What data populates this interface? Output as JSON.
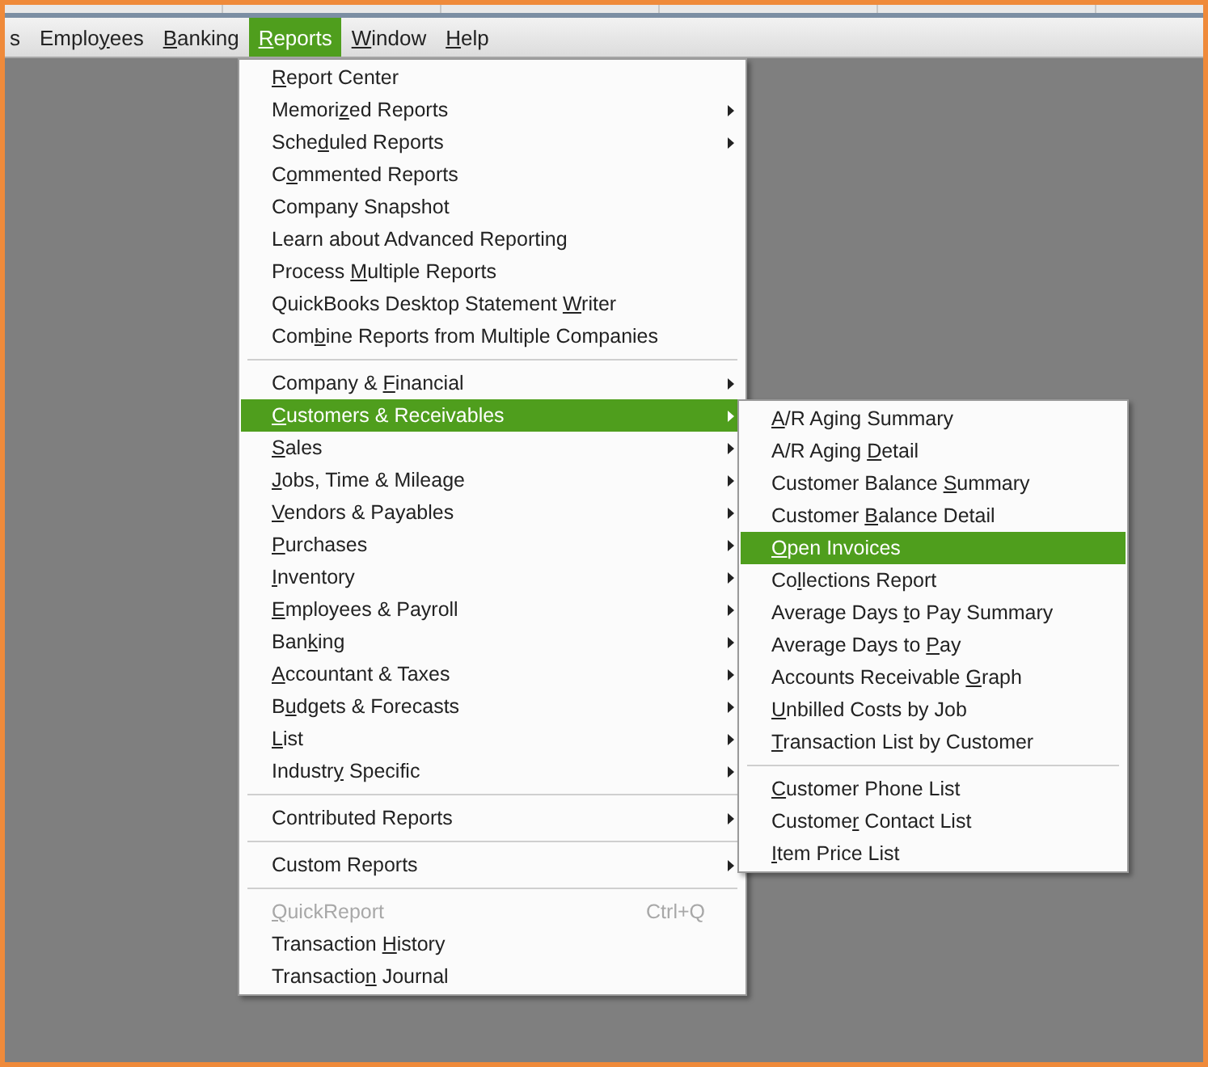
{
  "menu_bar": {
    "items": [
      {
        "label": "s",
        "selected": false
      },
      {
        "accel": {
          "before": "Emplo",
          "key": "y",
          "after": "ees"
        },
        "selected": false
      },
      {
        "accel": {
          "key": "B",
          "after": "anking"
        },
        "selected": false
      },
      {
        "accel": {
          "key": "R",
          "after": "eports"
        },
        "selected": true
      },
      {
        "accel": {
          "key": "W",
          "after": "indow"
        },
        "selected": false
      },
      {
        "accel": {
          "key": "H",
          "after": "elp"
        },
        "selected": false
      }
    ]
  },
  "reports_menu": {
    "sections": [
      [
        {
          "accel": {
            "key": "R",
            "after": "eport Center"
          },
          "submenu": false,
          "disabled": false,
          "selected": false
        },
        {
          "accel": {
            "before": "Memori",
            "key": "z",
            "after": "ed Reports"
          },
          "submenu": true,
          "disabled": false,
          "selected": false
        },
        {
          "accel": {
            "before": "Sche",
            "key": "d",
            "after": "uled Reports"
          },
          "submenu": true,
          "disabled": false,
          "selected": false
        },
        {
          "accel": {
            "before": "C",
            "key": "o",
            "after": "mmented Reports"
          },
          "submenu": false,
          "disabled": false,
          "selected": false
        },
        {
          "label": "Company Snapshot",
          "submenu": false,
          "disabled": false,
          "selected": false
        },
        {
          "label": "Learn about  Advanced Reporting",
          "submenu": false,
          "disabled": false,
          "selected": false
        },
        {
          "accel": {
            "before": "Process ",
            "key": "M",
            "after": "ultiple Reports"
          },
          "submenu": false,
          "disabled": false,
          "selected": false
        },
        {
          "accel": {
            "before": "QuickBooks Desktop Statement ",
            "key": "W",
            "after": "riter"
          },
          "submenu": false,
          "disabled": false,
          "selected": false
        },
        {
          "accel": {
            "before": "Com",
            "key": "b",
            "after": "ine Reports from Multiple Companies"
          },
          "submenu": false,
          "disabled": false,
          "selected": false
        }
      ],
      [
        {
          "accel": {
            "before": "Company & ",
            "key": "F",
            "after": "inancial"
          },
          "submenu": true,
          "disabled": false,
          "selected": false
        },
        {
          "accel": {
            "key": "C",
            "after": "ustomers & Receivables"
          },
          "submenu": true,
          "disabled": false,
          "selected": true
        },
        {
          "accel": {
            "key": "S",
            "after": "ales"
          },
          "submenu": true,
          "disabled": false,
          "selected": false
        },
        {
          "accel": {
            "key": "J",
            "after": "obs, Time & Mileage"
          },
          "submenu": true,
          "disabled": false,
          "selected": false
        },
        {
          "accel": {
            "key": "V",
            "after": "endors & Payables"
          },
          "submenu": true,
          "disabled": false,
          "selected": false
        },
        {
          "accel": {
            "key": "P",
            "after": "urchases"
          },
          "submenu": true,
          "disabled": false,
          "selected": false
        },
        {
          "accel": {
            "key": "I",
            "after": "nventory"
          },
          "submenu": true,
          "disabled": false,
          "selected": false
        },
        {
          "accel": {
            "key": "E",
            "after": "mployees & Payroll"
          },
          "submenu": true,
          "disabled": false,
          "selected": false
        },
        {
          "accel": {
            "before": "Ban",
            "key": "k",
            "after": "ing"
          },
          "submenu": true,
          "disabled": false,
          "selected": false
        },
        {
          "accel": {
            "key": "A",
            "after": "ccountant & Taxes"
          },
          "submenu": true,
          "disabled": false,
          "selected": false
        },
        {
          "accel": {
            "before": "B",
            "key": "u",
            "after": "dgets & Forecasts"
          },
          "submenu": true,
          "disabled": false,
          "selected": false
        },
        {
          "accel": {
            "key": "L",
            "after": "ist"
          },
          "submenu": true,
          "disabled": false,
          "selected": false
        },
        {
          "accel": {
            "before": "Industr",
            "key": "y",
            "after": " Specific"
          },
          "submenu": true,
          "disabled": false,
          "selected": false
        }
      ],
      [
        {
          "label": "Contributed Reports",
          "submenu": true,
          "disabled": false,
          "selected": false
        }
      ],
      [
        {
          "label": "Custom Reports",
          "submenu": true,
          "disabled": false,
          "selected": false
        }
      ],
      [
        {
          "accel": {
            "key": "Q",
            "after": "uickReport"
          },
          "shortcut": "Ctrl+Q",
          "submenu": false,
          "disabled": true,
          "selected": false
        },
        {
          "accel": {
            "before": "Transaction ",
            "key": "H",
            "after": "istory"
          },
          "submenu": false,
          "disabled": false,
          "selected": false
        },
        {
          "accel": {
            "before": "Transactio",
            "key": "n",
            "after": " Journal"
          },
          "submenu": false,
          "disabled": false,
          "selected": false
        }
      ]
    ]
  },
  "customers_receivables_submenu": {
    "sections": [
      [
        {
          "accel": {
            "key": "A",
            "after": "/R Aging Summary"
          },
          "selected": false
        },
        {
          "accel": {
            "before": "A/R Aging ",
            "key": "D",
            "after": "etail"
          },
          "selected": false
        },
        {
          "accel": {
            "before": "Customer Balance ",
            "key": "S",
            "after": "ummary"
          },
          "selected": false
        },
        {
          "accel": {
            "before": "Customer ",
            "key": "B",
            "after": "alance Detail"
          },
          "selected": false
        },
        {
          "accel": {
            "key": "O",
            "after": "pen Invoices"
          },
          "selected": true
        },
        {
          "accel": {
            "before": "Co",
            "key": "l",
            "after": "lections Report"
          },
          "selected": false
        },
        {
          "accel": {
            "before": "Average Days ",
            "key": "t",
            "after": "o Pay Summary"
          },
          "selected": false
        },
        {
          "accel": {
            "before": "Average Days to ",
            "key": "P",
            "after": "ay"
          },
          "selected": false
        },
        {
          "accel": {
            "before": "Accounts Receivable ",
            "key": "G",
            "after": "raph"
          },
          "selected": false
        },
        {
          "accel": {
            "key": "U",
            "after": "nbilled Costs by Job"
          },
          "selected": false
        },
        {
          "accel": {
            "key": "T",
            "after": "ransaction List by Customer"
          },
          "selected": false
        }
      ],
      [
        {
          "accel": {
            "key": "C",
            "after": "ustomer Phone List"
          },
          "selected": false
        },
        {
          "accel": {
            "before": "Custome",
            "key": "r",
            "after": " Contact List"
          },
          "selected": false
        },
        {
          "accel": {
            "key": "I",
            "after": "tem Price List"
          },
          "selected": false
        }
      ]
    ]
  }
}
